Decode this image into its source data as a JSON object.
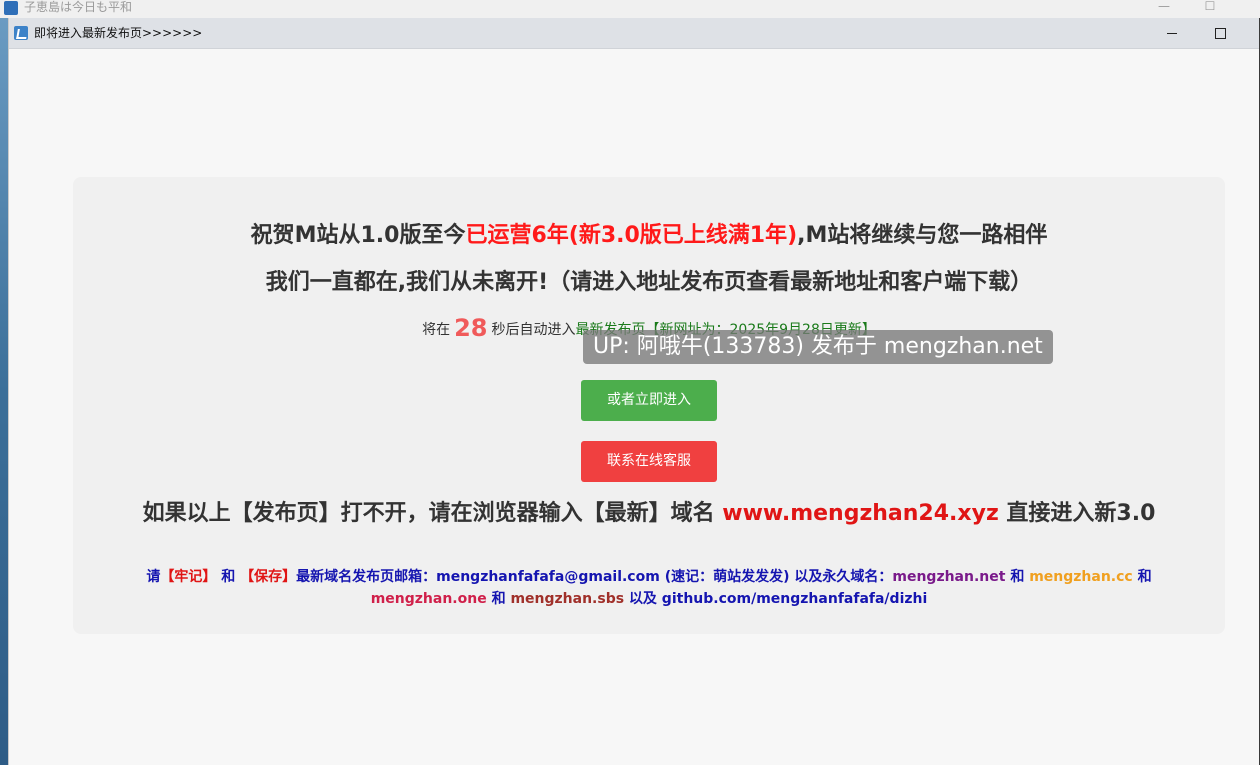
{
  "background_window": {
    "title": "子恵島は今日も平和",
    "controls": {
      "minimize": "—",
      "maximize": "☐"
    }
  },
  "window": {
    "title": "即将进入最新发布页>>>>>>",
    "controls": {
      "minimize": "minimize",
      "maximize": "maximize"
    }
  },
  "notice": {
    "line1_prefix": "祝贺M站从1.0版至今",
    "line1_highlight": "已运营6年(新3.0版已上线满1年)",
    "line1_suffix": ",M站将继续与您一路相伴",
    "line2": "我们一直都在,我们从未离开!（请进入地址发布页查看最新地址和客户端下载）",
    "countdown_prefix": "将在",
    "countdown_seconds": "28",
    "countdown_suffix": "秒后自动进入",
    "countdown_link": "最新发布页【新网址为：2025年9月28日更新】",
    "watermark": "UP: 阿哦牛(133783) 发布于 mengzhan.net",
    "enter_button": "或者立即进入",
    "support_button": "联系在线客服",
    "fallback_prefix": "如果以上【发布页】打不开，请在浏览器输入【最新】域名",
    "fallback_domain": "www.mengzhan24.xyz",
    "fallback_suffix": "直接进入新3.0",
    "info_p1": "请",
    "info_remember": "【牢记】",
    "info_and1": "和",
    "info_save": "【保存】",
    "info_p2": "最新域名发布页邮箱：mengzhanfafafa@gmail.com (速记：萌站发发发) 以及永久域名：",
    "info_domain1": "mengzhan.net",
    "info_and2": "和",
    "info_domain2": "mengzhan.cc",
    "info_and3": "和",
    "info_domain3": "mengzhan.one",
    "info_and4": "和",
    "info_domain4": "mengzhan.sbs",
    "info_p3": "以及 github.com/mengzhanfafafa/dizhi"
  },
  "colors": {
    "highlight_red": "#ff1a1a",
    "button_green": "#4cae4c",
    "button_red": "#f04040",
    "info_blue": "#1515b0"
  }
}
